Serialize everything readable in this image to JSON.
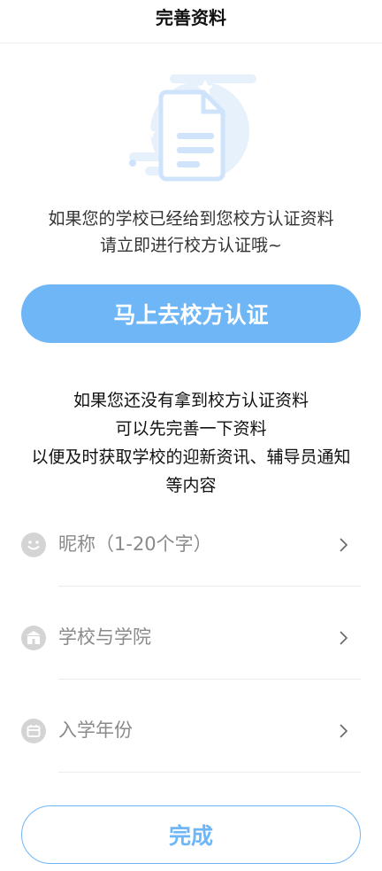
{
  "header": {
    "title": "完善资料"
  },
  "intro": {
    "line1": "如果您的学校已经给到您校方认证资料",
    "line2": "请立即进行校方认证哦~"
  },
  "primary_button": {
    "label": "马上去校方认证"
  },
  "info": {
    "line1": "如果您还没有拿到校方认证资料",
    "line2": "可以先完善一下资料",
    "line3": "以便及时获取学校的迎新资讯、辅导员通知",
    "line4": "等内容"
  },
  "form": {
    "nickname": {
      "label": "昵称（1-20个字）",
      "icon": "smiley-icon"
    },
    "school": {
      "label": "学校与学院",
      "icon": "school-building-icon"
    },
    "year": {
      "label": "入学年份",
      "icon": "calendar-icon"
    }
  },
  "done_button": {
    "label": "完成"
  },
  "colors": {
    "accent": "#6fb6f7",
    "illustration": "#cfe4fb",
    "icon_bg": "#d4d4d4"
  }
}
